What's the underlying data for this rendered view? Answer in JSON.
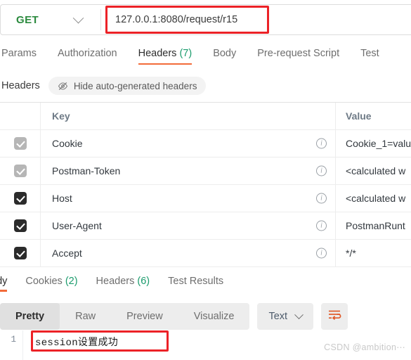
{
  "request_bar": {
    "method": "GET",
    "method_color": "#2b8a3e",
    "url": "127.0.0.1:8080/request/r15",
    "dropdown_icon": "chevron-down-icon",
    "highlight_color": "#ec2227"
  },
  "request_tabs": [
    {
      "label": "Params",
      "count": "",
      "active": false
    },
    {
      "label": "Authorization",
      "count": "",
      "active": false
    },
    {
      "label": "Headers",
      "count": "(7)",
      "active": true
    },
    {
      "label": "Body",
      "count": "",
      "active": false
    },
    {
      "label": "Pre-request Script",
      "count": "",
      "active": false
    },
    {
      "label": "Test",
      "count": "",
      "active": false
    }
  ],
  "headers_section": {
    "title": "Headers",
    "toggle_label": "Hide auto-generated headers",
    "toggle_icon": "eye-off-icon"
  },
  "headers_table": {
    "columns": [
      "Key",
      "Value"
    ],
    "rows": [
      {
        "checked": true,
        "disabled": true,
        "key": "Cookie",
        "value": "Cookie_1=valu"
      },
      {
        "checked": true,
        "disabled": true,
        "key": "Postman-Token",
        "value": "<calculated w"
      },
      {
        "checked": true,
        "disabled": false,
        "key": "Host",
        "value": "<calculated w"
      },
      {
        "checked": true,
        "disabled": false,
        "key": "User-Agent",
        "value": "PostmanRunt"
      },
      {
        "checked": true,
        "disabled": false,
        "key": "Accept",
        "value": "*/*"
      }
    ]
  },
  "response_tabs": [
    {
      "label": "ody",
      "count": "",
      "active": true
    },
    {
      "label": "Cookies",
      "count": "(2)",
      "active": false
    },
    {
      "label": "Headers",
      "count": "(6)",
      "active": false
    },
    {
      "label": "Test Results",
      "count": "",
      "active": false
    }
  ],
  "view_toolbar": {
    "modes": [
      "Pretty",
      "Raw",
      "Preview",
      "Visualize"
    ],
    "selected_mode": "Pretty",
    "format": "Text",
    "format_icon": "chevron-down-icon",
    "wrap_icon": "word-wrap-icon",
    "wrap_icon_color": "#e05a29"
  },
  "response_body": {
    "line_number": "1",
    "text": "session设置成功"
  },
  "watermark": "CSDN @ambition⋯",
  "accent": {
    "orange": "#f26b3a",
    "green": "#1a9b6c",
    "red": "#ec2227"
  }
}
